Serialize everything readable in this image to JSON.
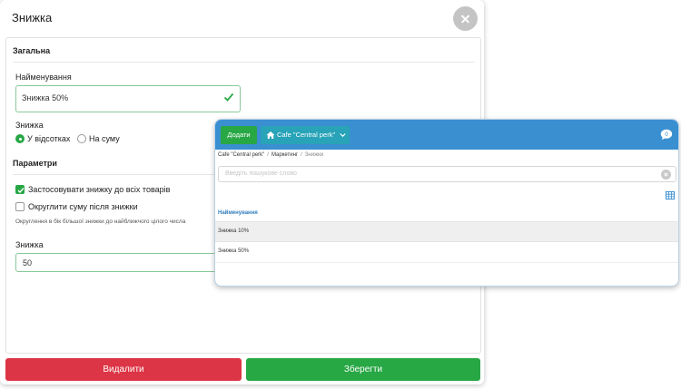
{
  "modal": {
    "title": "Знижка",
    "general": {
      "section_title": "Загальна",
      "name_label": "Найменування",
      "name_value": "Знижка 50%",
      "discount_label": "Знижка",
      "radio_options": [
        {
          "label": "У відсотках",
          "selected": true
        },
        {
          "label": "На суму",
          "selected": false
        }
      ]
    },
    "params": {
      "section_title": "Параметри",
      "checkboxes": [
        {
          "label": "Застосовувати знижку до всіх товарів",
          "checked": true
        },
        {
          "label": "Округлити суму після знижки",
          "checked": false
        }
      ],
      "hint": "Округлення в бік більшої знижки до найближчого цілого числа",
      "value_label": "Знижка",
      "value": "50"
    },
    "buttons": {
      "delete": "Видалити",
      "save": "Зберегти"
    }
  },
  "panel": {
    "add_button": "Додати",
    "cafe_button": "Cafe \"Central perk\"",
    "chat_badge": "0",
    "breadcrumb": [
      "Cafe \"Central perk\"",
      "Маркетинг",
      "Знижки"
    ],
    "search_placeholder": "Введіть пошукове слово",
    "column_header": "Найменування",
    "rows": [
      "Знижка 10%",
      "Знижка 50%"
    ]
  },
  "colors": {
    "green": "#28a745",
    "red": "#dc3545",
    "blue_bar": "#3a8fd1",
    "teal_button": "#28a3b8",
    "header_link": "#2f7dbd"
  }
}
